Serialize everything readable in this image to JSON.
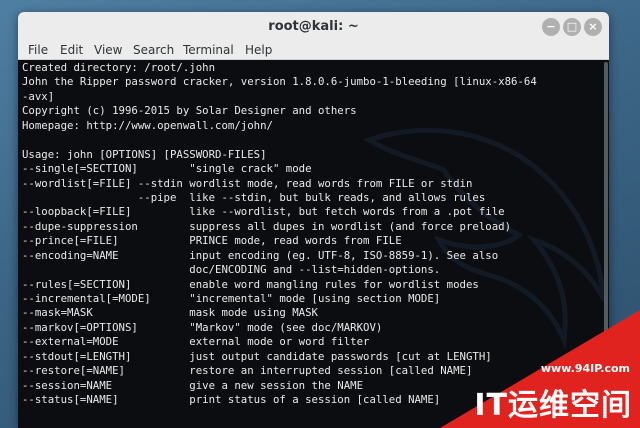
{
  "window": {
    "title": "root@kali: ~",
    "buttons": {
      "minimize": "−",
      "maximize": "□",
      "close": "×"
    }
  },
  "menu": [
    "File",
    "Edit",
    "View",
    "Search",
    "Terminal",
    "Help"
  ],
  "terminal": {
    "lines": [
      "Created directory: /root/.john",
      "John the Ripper password cracker, version 1.8.0.6-jumbo-1-bleeding [linux-x86-64",
      "-avx]",
      "Copyright (c) 1996-2015 by Solar Designer and others",
      "Homepage: http://www.openwall.com/john/",
      "",
      "Usage: john [OPTIONS] [PASSWORD-FILES]",
      "--single[=SECTION]        \"single crack\" mode",
      "--wordlist[=FILE] --stdin wordlist mode, read words from FILE or stdin",
      "                  --pipe  like --stdin, but bulk reads, and allows rules",
      "--loopback[=FILE]         like --wordlist, but fetch words from a .pot file",
      "--dupe-suppression        suppress all dupes in wordlist (and force preload)",
      "--prince[=FILE]           PRINCE mode, read words from FILE",
      "--encoding=NAME           input encoding (eg. UTF-8, ISO-8859-1). See also",
      "                          doc/ENCODING and --list=hidden-options.",
      "--rules[=SECTION]         enable word mangling rules for wordlist modes",
      "--incremental[=MODE]      \"incremental\" mode [using section MODE]",
      "--mask=MASK               mask mode using MASK",
      "--markov[=OPTIONS]        \"Markov\" mode (see doc/MARKOV)",
      "--external=MODE           external mode or word filter",
      "--stdout[=LENGTH]         just output candidate passwords [cut at LENGTH]",
      "--restore[=NAME]          restore an interrupted session [called NAME]",
      "--session=NAME            give a new session the NAME",
      "--status[=NAME]           print status of a session [called NAME]"
    ]
  },
  "watermark": {
    "url": "www.94IP.com",
    "text": "IT运维空间"
  },
  "colors": {
    "terminal_bg": "#0b0d10",
    "terminal_fg": "#eaeaea",
    "watermark_red": "#e0231f",
    "desktop_bg": "#3b6485"
  }
}
